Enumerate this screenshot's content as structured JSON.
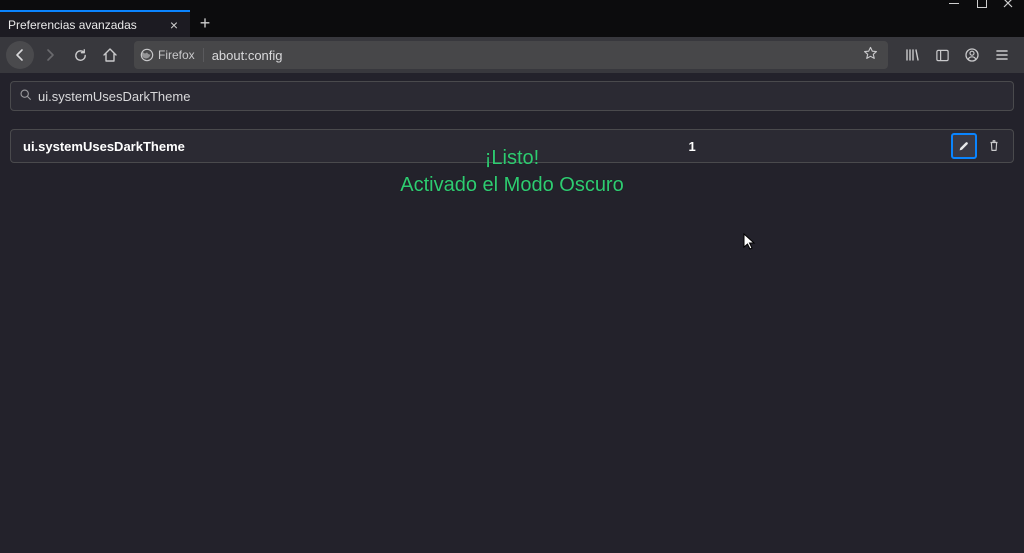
{
  "window": {
    "tab_title": "Preferencias avanzadas",
    "urlbar_identity": "Firefox",
    "url": "about:config"
  },
  "config": {
    "search_value": "ui.systemUsesDarkTheme",
    "pref_name": "ui.systemUsesDarkTheme",
    "pref_value": "1"
  },
  "overlay": {
    "line1": "¡Listo!",
    "line2": "Activado el Modo Oscuro"
  }
}
